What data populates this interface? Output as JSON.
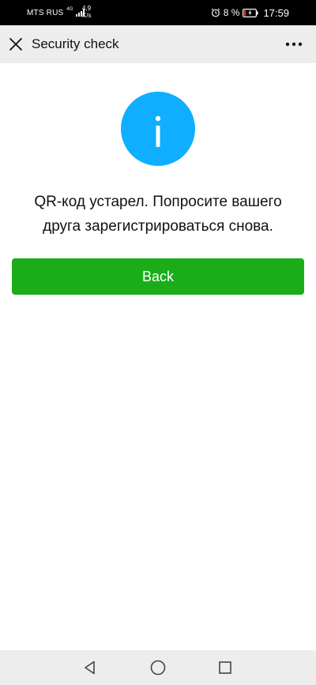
{
  "status_bar": {
    "carrier": "MTS RUS",
    "network_type": "4G",
    "speed_value": "4,9",
    "speed_unit": "K/s",
    "battery_percent": "8 %",
    "time": "17:59"
  },
  "title_bar": {
    "title": "Security check"
  },
  "content": {
    "message": "QR-код устарел. Попросите вашего друга зарегистрироваться снова.",
    "back_button_label": "Back"
  },
  "colors": {
    "info_circle": "#10aeff",
    "primary_button": "#1aad19",
    "title_bar_bg": "#ededed"
  },
  "icons": {
    "close": "close-icon",
    "more": "more-icon",
    "info": "info-icon",
    "nav_back": "triangle-back-icon",
    "nav_home": "circle-home-icon",
    "nav_recents": "square-recents-icon"
  }
}
